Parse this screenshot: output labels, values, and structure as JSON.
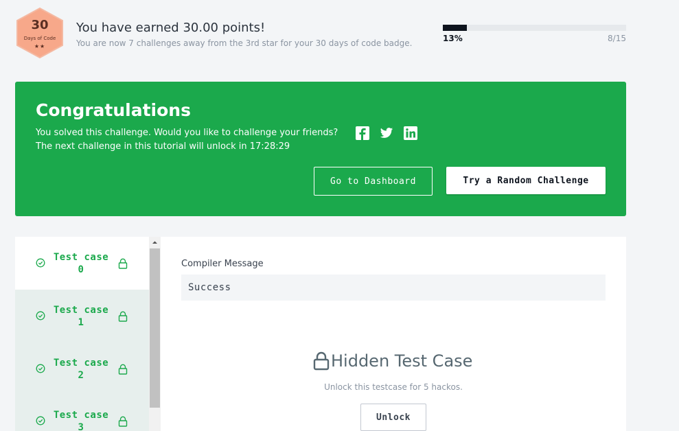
{
  "header": {
    "badge": {
      "number": "30",
      "label": "Days of Code",
      "stars": "★★"
    },
    "title": "You have earned 30.00 points!",
    "subtitle": "You are now 7 challenges away from the 3rd star for your 30 days of code badge.",
    "progress": {
      "percent_label": "13%",
      "fraction": 0.13,
      "count": "8/15"
    }
  },
  "banner": {
    "title": "Congratulations",
    "message": "You solved this challenge. Would you like to challenge your friends?",
    "unlock_text": "The next challenge in this tutorial will unlock in 17:28:29",
    "social": [
      "facebook-icon",
      "twitter-icon",
      "linkedin-icon"
    ],
    "dashboard_button": "Go to Dashboard",
    "random_button": "Try a Random Challenge",
    "color": "#1ba94c"
  },
  "test_cases": [
    {
      "label_line1": "Test case",
      "label_line2": "0",
      "active": true
    },
    {
      "label_line1": "Test case",
      "label_line2": "1",
      "active": false
    },
    {
      "label_line1": "Test case",
      "label_line2": "2",
      "active": false
    },
    {
      "label_line1": "Test case",
      "label_line2": "3",
      "active": false
    }
  ],
  "result": {
    "compiler_label": "Compiler Message",
    "compiler_value": "Success",
    "hidden_title": "Hidden Test Case",
    "hidden_subtitle": "Unlock this testcase for 5 hackos.",
    "unlock_button": "Unlock"
  }
}
